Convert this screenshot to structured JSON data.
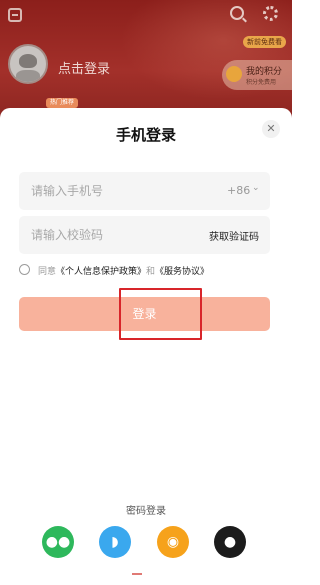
{
  "background": {
    "login_link": "点击登录",
    "new_user_badge": "新前免费看",
    "points_title": "我的积分",
    "points_subtitle": "积分免费用",
    "hot_badge": "热门推荐"
  },
  "sheet": {
    "title": "手机登录",
    "close_icon": "close-icon",
    "phone_placeholder": "请输入手机号",
    "country_code": "+86",
    "code_placeholder": "请输入校验码",
    "get_code_label": "获取验证码",
    "agree_prefix": "同意",
    "privacy_link": "《个人信息保护政策》",
    "agree_and": "和",
    "service_link": "《服务协议》",
    "login_button": "登录",
    "password_login": "密码登录",
    "social_icons": [
      "wechat-icon",
      "qq-icon",
      "weibo-icon",
      "apple-icon"
    ]
  },
  "colors": {
    "login_button": "#f8b29c",
    "highlight": "#d8252a",
    "header_bg": "#8c1f1b",
    "wechat": "#2eb85c",
    "qq": "#3aa8ee",
    "weibo": "#f6a21b",
    "apple": "#1c1c1c"
  }
}
